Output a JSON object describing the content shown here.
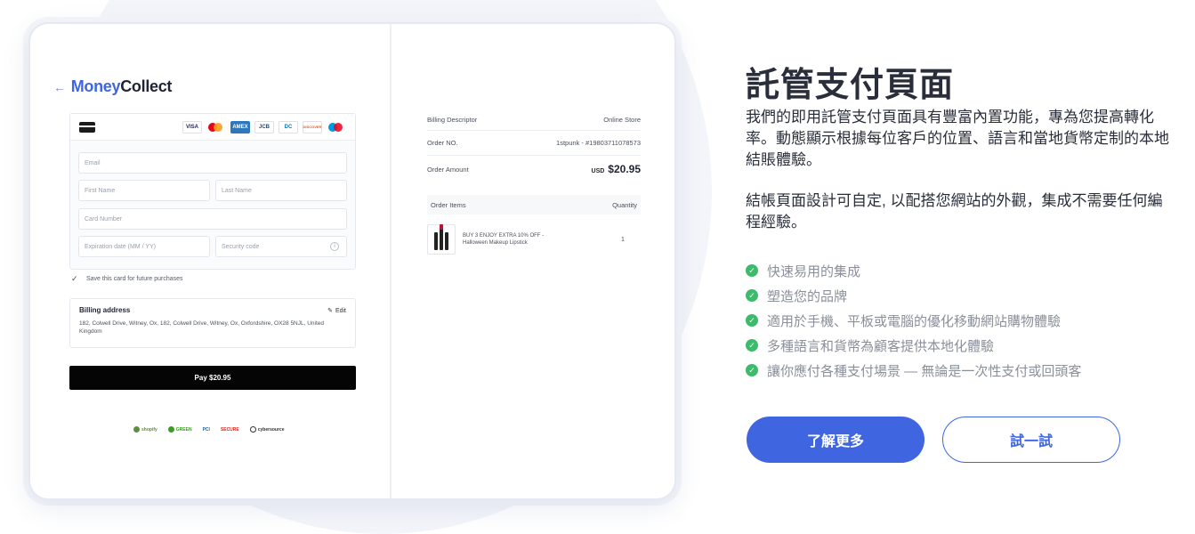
{
  "checkout": {
    "logo": {
      "back_arrow": "←",
      "part1": "Money",
      "part2": "Collect"
    },
    "card_brands": [
      "VISA",
      "MC",
      "AMEX",
      "JCB",
      "DC",
      "DISCOVER",
      "MAESTRO"
    ],
    "fields": {
      "email_placeholder": "Email",
      "first_name_placeholder": "First Name",
      "last_name_placeholder": "Last Name",
      "card_number_placeholder": "Card Number",
      "expiration_placeholder": "Expiration date (MM / YY)",
      "security_placeholder": "Security code"
    },
    "save_card_label": "Save this card for future purchases",
    "billing": {
      "title": "Billing address",
      "edit_label": "Edit",
      "address": "182, Colwell Drive, Witney, Ox, 182, Colwell Drive, Witney, Ox, Oxfordshire, OX28 5NJL, United Kingdom"
    },
    "pay_button": "Pay $20.95",
    "trust_badges": [
      "shopify",
      "GREEN",
      "PCI",
      "SECURE",
      "cybersource"
    ]
  },
  "summary": {
    "billing_descriptor_label": "Billing Descriptor",
    "billing_descriptor_value": "Online Store",
    "order_no_label": "Order NO.",
    "order_no_value": "1stpunk - #19803711078573",
    "order_amount_label": "Order Amount",
    "currency": "USD",
    "amount": "$20.95",
    "items_label": "Order Items",
    "quantity_label": "Quantity",
    "item_name": "BUY 3 ENJOY EXTRA 10% OFF - Halloween Makeup Lipstick",
    "item_qty": "1"
  },
  "marketing": {
    "title": "託管支付頁面",
    "description1": "我們的即用託管支付頁面具有豐富內置功能，專為您提高轉化率。動態顯示根據每位客戶的位置、語言和當地貨幣定制的本地結賬體驗。",
    "description2": "結帳頁面設計可自定, 以配搭您網站的外觀，集成不需要任何編程經驗。",
    "features": [
      "快速易用的集成",
      "塑造您的品牌",
      "適用於手機、平板或電腦的優化移動網站購物體驗",
      "多種語言和貨幣為顧客提供本地化體驗",
      "讓你應付各種支付場景 — 無論是一次性支付或回頭客"
    ],
    "primary_button": "了解更多",
    "secondary_button": "試一試",
    "check_mark": "✓"
  },
  "colors": {
    "accent": "#3f66e0",
    "check": "#3dbb6c",
    "pay_button": "#050505"
  }
}
